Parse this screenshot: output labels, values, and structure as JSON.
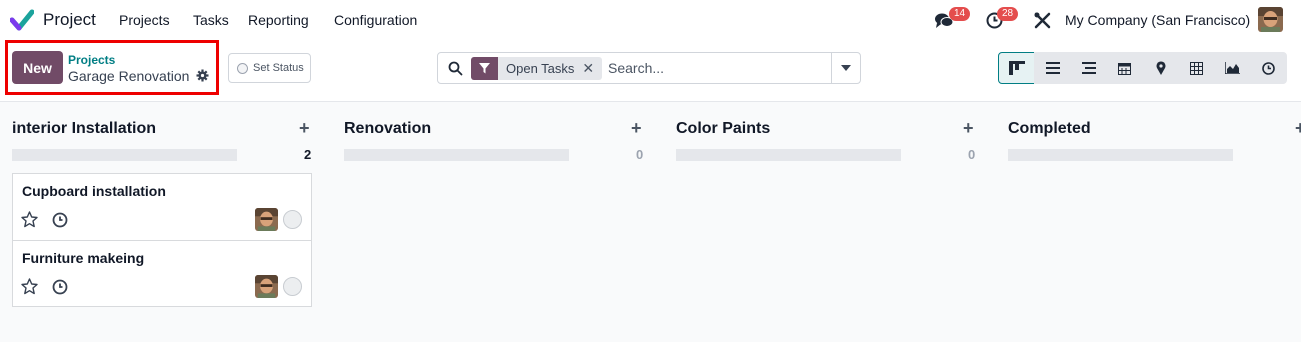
{
  "topnav": {
    "app_name": "Project",
    "menu": [
      "Projects",
      "Tasks",
      "Reporting",
      "Configuration"
    ],
    "messages_badge": "14",
    "activity_badge": "28",
    "company": "My Company (San Francisco)"
  },
  "control": {
    "new_label": "New",
    "breadcrumb_parent": "Projects",
    "breadcrumb_current": "Garage Renovation",
    "set_status_label": "Set Status"
  },
  "search": {
    "facet_label": "Open Tasks",
    "placeholder": "Search..."
  },
  "views": [
    "kanban",
    "list",
    "gantt",
    "calendar",
    "map",
    "pivot",
    "graph",
    "activity"
  ],
  "columns": [
    {
      "title": "interior Installation",
      "count": "2"
    },
    {
      "title": "Renovation",
      "count": "0"
    },
    {
      "title": "Color Paints",
      "count": "0"
    },
    {
      "title": "Completed",
      "count": ""
    }
  ],
  "cards": [
    {
      "title": "Cupboard installation"
    },
    {
      "title": "Furniture makeing"
    }
  ],
  "colors": {
    "brand": "#714b67",
    "accent": "#017e84",
    "badge": "#e44d4d",
    "highlight": "#ee0000"
  }
}
